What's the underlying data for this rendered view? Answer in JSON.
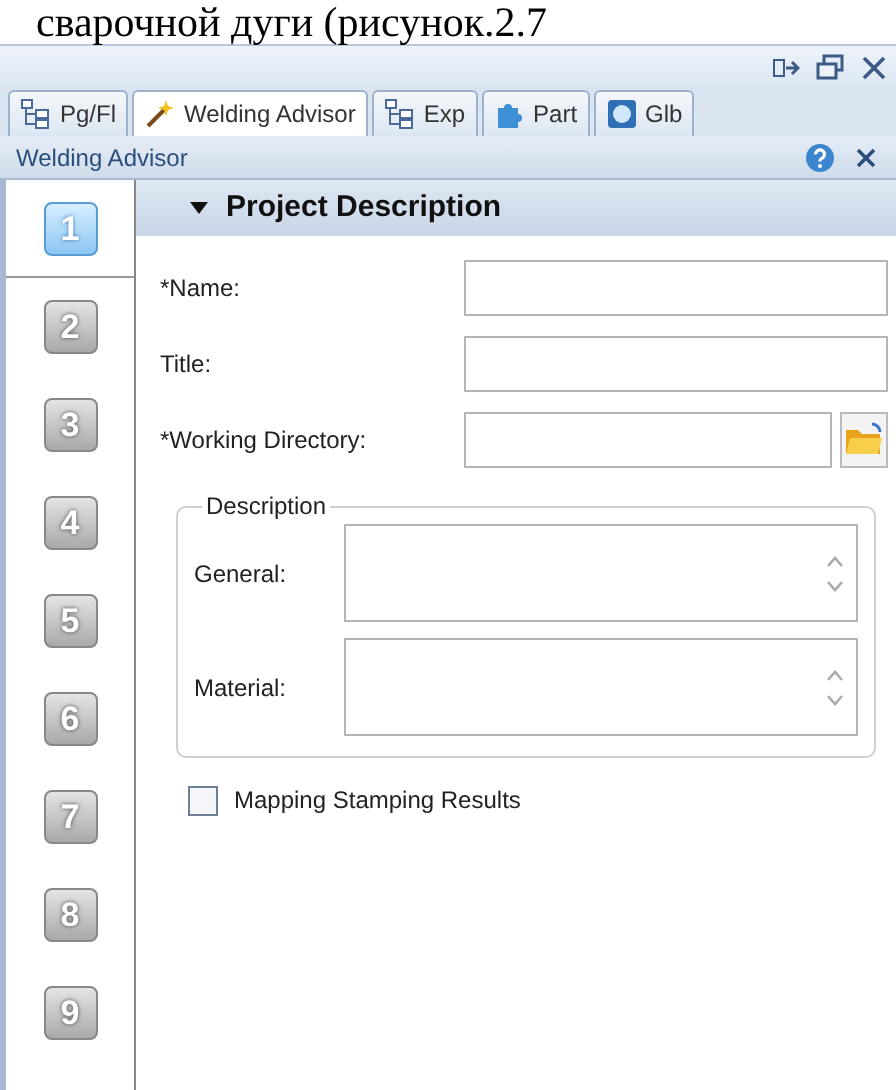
{
  "document_text": "сварочной дуги (рисунок.2.7",
  "tabs": [
    {
      "label": "Pg/Fl",
      "selected": false,
      "kind": "tree"
    },
    {
      "label": "Welding Advisor",
      "selected": true,
      "kind": "wand"
    },
    {
      "label": "Exp",
      "selected": false,
      "kind": "tree"
    },
    {
      "label": "Part",
      "selected": false,
      "kind": "puzzle"
    },
    {
      "label": "Glb",
      "selected": false,
      "kind": "globe"
    }
  ],
  "panel": {
    "title": "Welding Advisor"
  },
  "steps": [
    {
      "label": "1",
      "selected": true
    },
    {
      "label": "2",
      "selected": false
    },
    {
      "label": "3",
      "selected": false
    },
    {
      "label": "4",
      "selected": false
    },
    {
      "label": "5",
      "selected": false
    },
    {
      "label": "6",
      "selected": false
    },
    {
      "label": "7",
      "selected": false
    },
    {
      "label": "8",
      "selected": false
    },
    {
      "label": "9",
      "selected": false
    }
  ],
  "section": {
    "title": "Project Description",
    "expanded": true
  },
  "fields": [
    {
      "label": "*Name:",
      "kind": "text"
    },
    {
      "label": "Title:",
      "kind": "text"
    },
    {
      "label": "*Working Directory:",
      "kind": "folder"
    }
  ],
  "description": {
    "title": "Description",
    "fields": [
      {
        "label": "General:"
      },
      {
        "label": "Material:"
      }
    ]
  },
  "checkbox": {
    "label": "Mapping Stamping Results",
    "checked": false
  }
}
